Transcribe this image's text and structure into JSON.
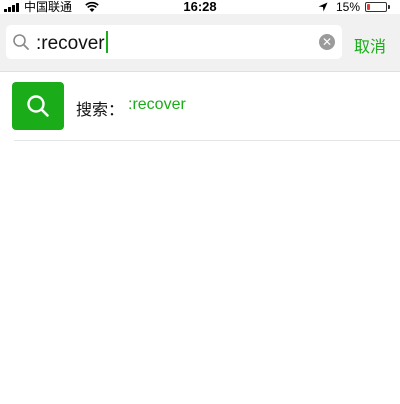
{
  "status_bar": {
    "carrier": "中国联通",
    "time": "16:28",
    "battery": "15%",
    "battery_level": 0.15
  },
  "search": {
    "icon": "search-icon",
    "value": ":recover",
    "clear_icon": "clear-icon",
    "cancel_label": "取消"
  },
  "suggestion": {
    "icon": "search-icon",
    "label": "搜索：",
    "query": ":recover"
  },
  "colors": {
    "accent": "#1aad19",
    "header_bg": "#f1f1f1",
    "battery_low": "#e23b3b"
  }
}
